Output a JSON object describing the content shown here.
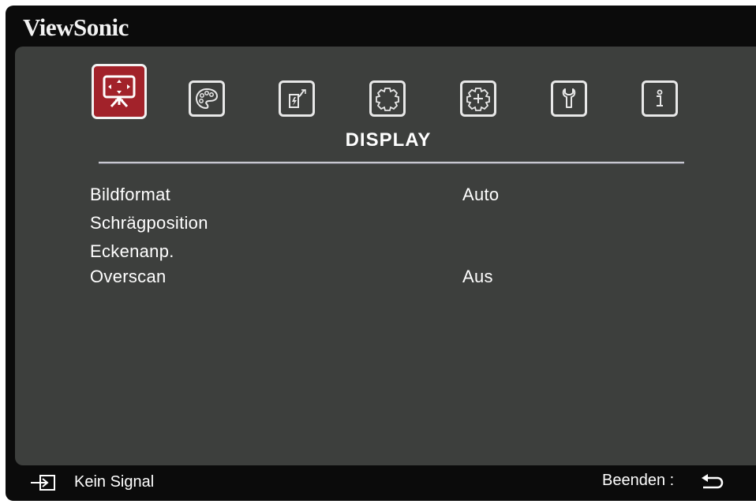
{
  "brand": "ViewSonic",
  "tabs": [
    {
      "name": "display",
      "icon": "display-icon",
      "active": true
    },
    {
      "name": "image-setting",
      "icon": "palette-icon",
      "active": false
    },
    {
      "name": "power-management",
      "icon": "power-plug-icon",
      "active": false
    },
    {
      "name": "basic",
      "icon": "gear-icon",
      "active": false
    },
    {
      "name": "advanced",
      "icon": "advanced-gear-icon",
      "active": false
    },
    {
      "name": "system",
      "icon": "wrench-icon",
      "active": false
    },
    {
      "name": "information",
      "icon": "info-icon",
      "active": false
    }
  ],
  "section_title": "DISPLAY",
  "menu": [
    {
      "label": "Bildformat",
      "value": "Auto"
    },
    {
      "label": "Schrägposition",
      "value": ""
    },
    {
      "label": "Eckenanp.",
      "value": ""
    },
    {
      "label": "Overscan",
      "value": "Aus"
    }
  ],
  "footer": {
    "signal_text": "Kein Signal",
    "exit_text": "Beenden :"
  },
  "colors": {
    "active_tab": "#a2222a",
    "panel": "#3d3f3d",
    "frame": "#0b0b0b"
  }
}
